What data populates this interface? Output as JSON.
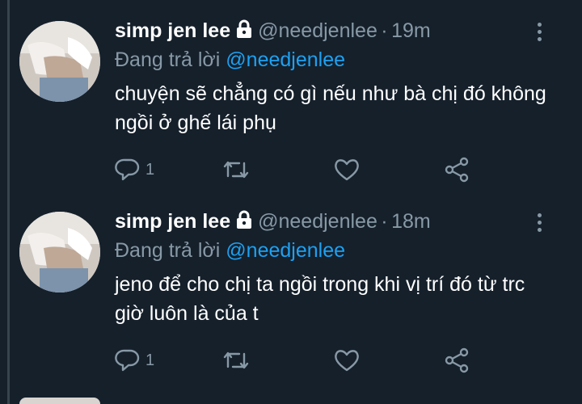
{
  "tweets": [
    {
      "name": "simp jen lee",
      "handle": "@needjenlee",
      "separator": "·",
      "time": "19m",
      "reply_prefix": "Đang trả lời",
      "reply_to": "@needjenlee",
      "text": "chuyện sẽ chẳng có gì nếu như bà chị đó không ngồi ở ghế lái phụ",
      "reply_count": "1",
      "icons": [
        "reply-icon",
        "retweet-icon",
        "like-icon",
        "share-icon"
      ]
    },
    {
      "name": "simp jen lee",
      "handle": "@needjenlee",
      "separator": "·",
      "time": "18m",
      "reply_prefix": "Đang trả lời",
      "reply_to": "@needjenlee",
      "text": "jeno để cho chị ta ngồi trong khi vị trí đó từ trc giờ luôn là của t",
      "reply_count": "1",
      "icons": [
        "reply-icon",
        "retweet-icon",
        "like-icon",
        "share-icon"
      ]
    }
  ],
  "colors": {
    "background": "#15202b",
    "secondary_text": "#8899a6",
    "mention": "#1da1f2",
    "thread_line": "#38444d"
  }
}
